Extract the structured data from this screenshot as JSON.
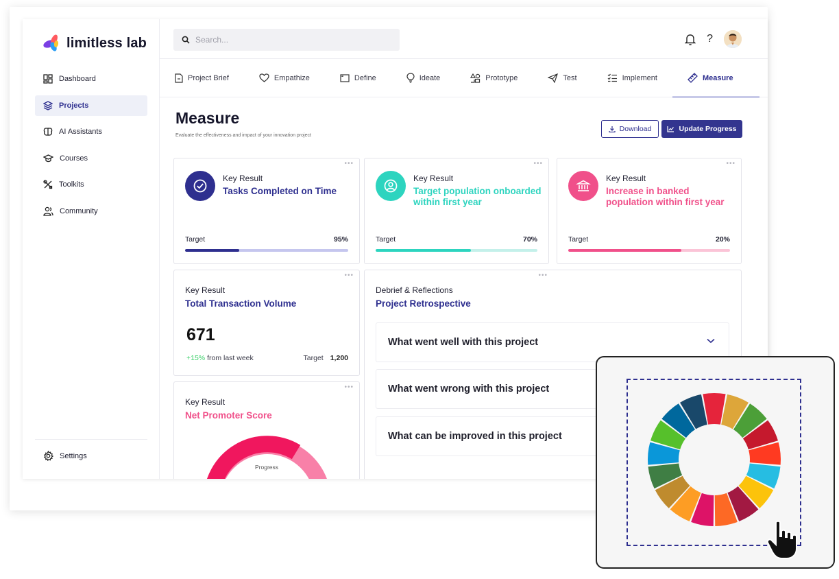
{
  "brand": {
    "name": "limitless lab"
  },
  "sidebar": {
    "items": [
      {
        "label": "Dashboard",
        "icon": "dashboard-icon",
        "active": false
      },
      {
        "label": "Projects",
        "icon": "layers-icon",
        "active": true
      },
      {
        "label": "AI Assistants",
        "icon": "brain-icon",
        "active": false
      },
      {
        "label": "Courses",
        "icon": "graduation-cap-icon",
        "active": false
      },
      {
        "label": "Toolkits",
        "icon": "tools-icon",
        "active": false
      },
      {
        "label": "Community",
        "icon": "users-icon",
        "active": false
      }
    ],
    "settings_label": "Settings"
  },
  "search": {
    "placeholder": "Search..."
  },
  "tabs": [
    {
      "label": "Project Brief",
      "icon": "document-icon"
    },
    {
      "label": "Empathize",
      "icon": "heart-icon"
    },
    {
      "label": "Define",
      "icon": "frame-icon"
    },
    {
      "label": "Ideate",
      "icon": "lightbulb-icon"
    },
    {
      "label": "Prototype",
      "icon": "shapes-icon"
    },
    {
      "label": "Test",
      "icon": "paper-plane-icon"
    },
    {
      "label": "Implement",
      "icon": "checklist-icon"
    },
    {
      "label": "Measure",
      "icon": "ruler-icon",
      "active": true
    }
  ],
  "page": {
    "title": "Measure",
    "subtitle": "Evaluate the effectiveness and impact of your innovation project"
  },
  "actions": {
    "download": "Download",
    "update": "Update Progress"
  },
  "key_results": [
    {
      "label": "Key Result",
      "title": "Tasks Completed on Time",
      "target_label": "Target",
      "target": "95%",
      "progress": 0.33,
      "color": "#2e2f8f",
      "track": "#c5c6ee",
      "icon": "check-circle-icon"
    },
    {
      "label": "Key Result",
      "title": "Target population onboarded within first year",
      "target_label": "Target",
      "target": "70%",
      "progress": 0.59,
      "color": "#2dd4bf",
      "track": "#c4f0ea",
      "icon": "user-circle-icon"
    },
    {
      "label": "Key Result",
      "title": "Increase in banked population within first year",
      "target_label": "Target",
      "target": "20%",
      "progress": 0.7,
      "color": "#f0508a",
      "track": "#fbc4d7",
      "icon": "bank-icon"
    }
  ],
  "volume": {
    "label": "Key Result",
    "title": "Total Transaction Volume",
    "value": "671",
    "change": "+15%",
    "change_suffix": "from last week",
    "target_label": "Target",
    "target": "1,200"
  },
  "nps": {
    "label": "Key Result",
    "title": "Net Promoter Score",
    "progress_label": "Progress"
  },
  "debrief": {
    "label": "Debrief & Reflections",
    "title": "Project Retrospective",
    "questions": [
      "What went well with this project",
      "What went wrong with this project",
      "What can be improved in this project"
    ]
  },
  "colors": {
    "primary": "#2e2f8f",
    "teal": "#2dd4bf",
    "pink": "#f0508a"
  }
}
